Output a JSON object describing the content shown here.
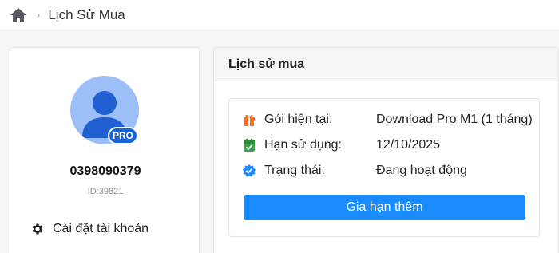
{
  "breadcrumb": {
    "home_icon": "home-icon",
    "separator": "›",
    "current": "Lịch Sử Mua"
  },
  "profile": {
    "badge": "PRO",
    "phone": "0398090379",
    "user_id": "ID:39821",
    "settings_label": "Cài đặt tài khoản",
    "avatar_color": "#9dbff7",
    "badge_color": "#1665d8"
  },
  "history": {
    "title": "Lịch sử mua",
    "rows": [
      {
        "icon": "gift-icon",
        "icon_color": "#f06c2c",
        "label": "Gói hiện tại:",
        "value": "Download Pro M1 (1 tháng)"
      },
      {
        "icon": "calendar-check-icon",
        "icon_color": "#3fa34d",
        "label": "Hạn sử dụng:",
        "value": "12/10/2025"
      },
      {
        "icon": "verified-badge-icon",
        "icon_color": "#1a8cff",
        "label": "Trạng thái:",
        "value": "Đang hoạt động"
      }
    ],
    "renew_label": "Gia hạn thêm",
    "button_color": "#1a8cff"
  }
}
